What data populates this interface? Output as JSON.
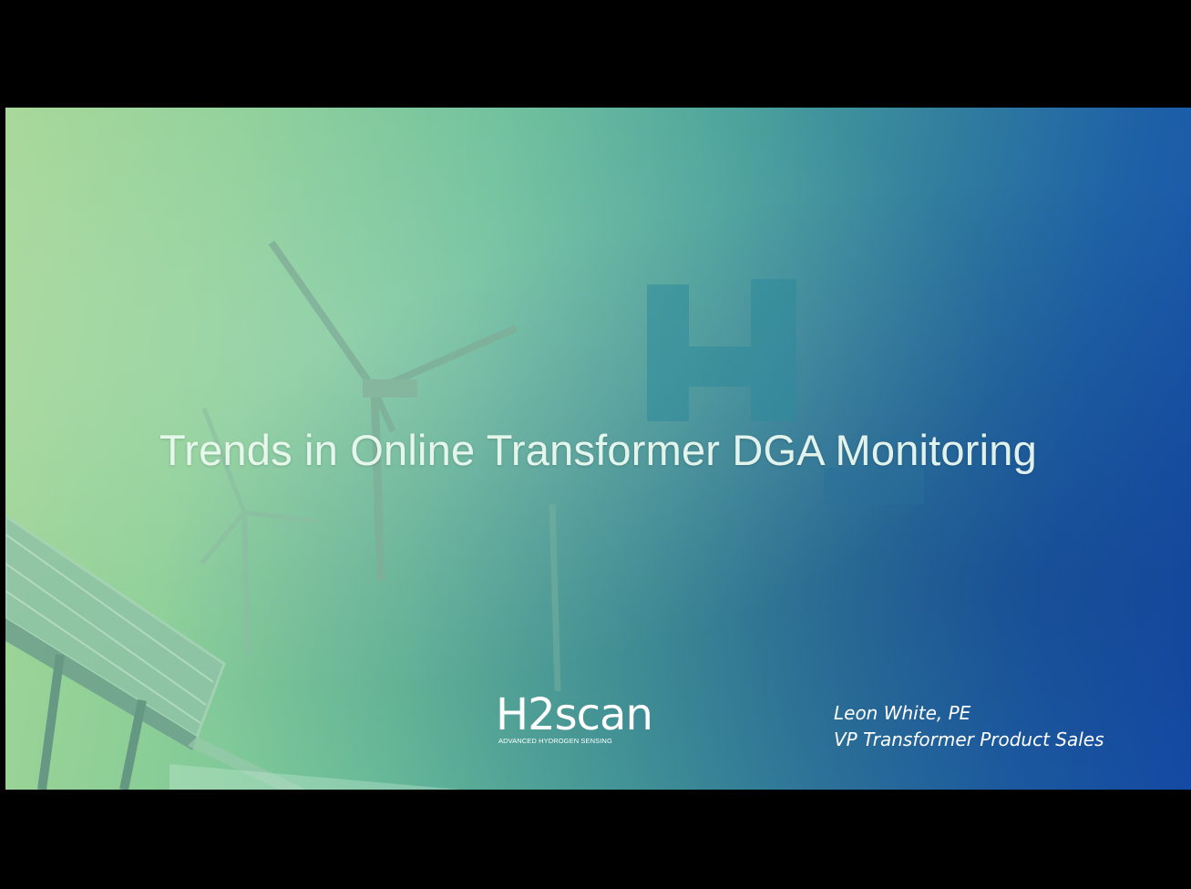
{
  "slide": {
    "title": "Trends in Online Transformer DGA Monitoring",
    "background_colors": [
      "#a6d797",
      "#6bbf99",
      "#327f9e",
      "#1650ac"
    ],
    "watermark": "H2"
  },
  "logo": {
    "wordmark": "H2scan",
    "tagline": "ADVANCED HYDROGEN SENSING"
  },
  "presenter": {
    "name": "Leon White, PE",
    "role": "VP Transformer Product Sales"
  }
}
